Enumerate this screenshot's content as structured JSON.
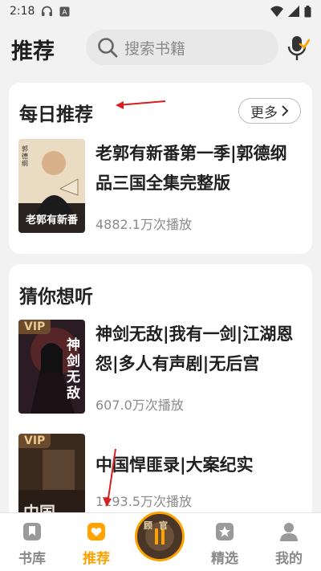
{
  "status_bar": {
    "time": "2:18"
  },
  "header": {
    "title": "推荐"
  },
  "search": {
    "placeholder": "搜索书籍"
  },
  "daily": {
    "title": "每日推荐",
    "more_label": "更多",
    "book": {
      "title": "老郭有新番第一季|郭德纲品三国全集完整版",
      "plays": "4882.1万次播放",
      "cover_caption": "老郭有新番",
      "cover_name": "郭德纲"
    }
  },
  "guess": {
    "title": "猜你想听",
    "books": [
      {
        "title": "神剑无敌|我有一剑|江湖恩怨|多人有声剧|无后宫",
        "plays": "607.0万次播放",
        "vip": "VIP",
        "cover_text": "神剑无敌"
      },
      {
        "title": "中国悍匪录|大案纪实",
        "plays": "1193.5万次播放",
        "vip": "VIP",
        "cover_text": "中国"
      }
    ]
  },
  "nav": {
    "items": [
      {
        "label": "书库",
        "icon": "bookmark-icon"
      },
      {
        "label": "推荐",
        "icon": "heart-box-icon"
      },
      {
        "label": "精选",
        "icon": "star-icon"
      },
      {
        "label": "我的",
        "icon": "person-icon"
      }
    ],
    "player_cover_text": "顾官"
  },
  "colors": {
    "accent": "#ffa200",
    "annotation": "#d81e1e"
  }
}
